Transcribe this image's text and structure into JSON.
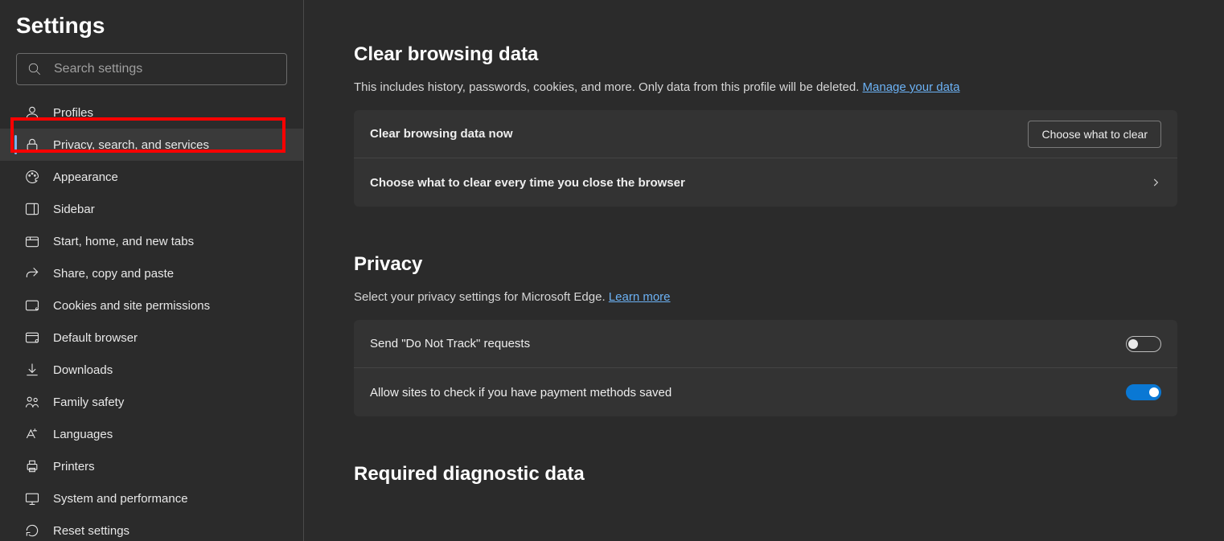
{
  "sidebar": {
    "title": "Settings",
    "search_placeholder": "Search settings",
    "items": [
      {
        "label": "Profiles"
      },
      {
        "label": "Privacy, search, and services"
      },
      {
        "label": "Appearance"
      },
      {
        "label": "Sidebar"
      },
      {
        "label": "Start, home, and new tabs"
      },
      {
        "label": "Share, copy and paste"
      },
      {
        "label": "Cookies and site permissions"
      },
      {
        "label": "Default browser"
      },
      {
        "label": "Downloads"
      },
      {
        "label": "Family safety"
      },
      {
        "label": "Languages"
      },
      {
        "label": "Printers"
      },
      {
        "label": "System and performance"
      },
      {
        "label": "Reset settings"
      }
    ]
  },
  "main": {
    "clear_browsing": {
      "title": "Clear browsing data",
      "desc_prefix": "This includes history, passwords, cookies, and more. Only data from this profile will be deleted. ",
      "manage_link": "Manage your data",
      "row_now_label": "Clear browsing data now",
      "choose_button": "Choose what to clear",
      "row_close_label": "Choose what to clear every time you close the browser"
    },
    "privacy": {
      "title": "Privacy",
      "desc_prefix": "Select your privacy settings for Microsoft Edge. ",
      "learn_link": "Learn more",
      "dnt_label": "Send \"Do Not Track\" requests",
      "payment_label": "Allow sites to check if you have payment methods saved"
    },
    "diagnostic": {
      "title": "Required diagnostic data"
    }
  }
}
